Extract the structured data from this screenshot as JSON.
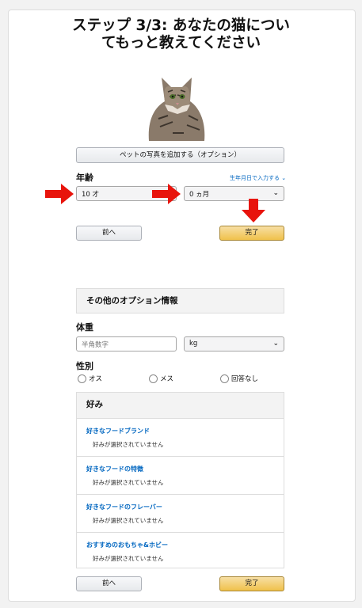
{
  "title": {
    "line1": "ステップ 3/3: あなたの猫につい",
    "line2": "てもっと教えてください"
  },
  "add_photo_label": "ペットの写真を追加する（オプション）",
  "age": {
    "label": "年齢",
    "birthday_link": "生年月日で入力する ⌄",
    "years_value": "10 才",
    "months_value": "0 ヵ月"
  },
  "nav": {
    "prev_label": "前へ",
    "done_label": "完了"
  },
  "optional": {
    "heading": "その他のオプション情報"
  },
  "weight": {
    "label": "体重",
    "placeholder": "半角数字",
    "unit_value": "kg"
  },
  "gender": {
    "label": "性別",
    "options": [
      "オス",
      "メス",
      "回答なし"
    ]
  },
  "preferences": {
    "heading": "好み",
    "items": [
      {
        "title": "好きなフードブランド",
        "status": "好みが選択されていません"
      },
      {
        "title": "好きなフードの特徴",
        "status": "好みが選択されていません"
      },
      {
        "title": "好きなフードのフレーバー",
        "status": "好みが選択されていません"
      },
      {
        "title": "おすすめのおもちゃ&ホビー",
        "status": "好みが選択されていません"
      }
    ]
  },
  "colors": {
    "accent_link": "#0066c0",
    "primary_button": "#f0c14b",
    "arrow": "#e8140c"
  },
  "icons": [
    "chevron-down-icon",
    "arrow-right-icon",
    "arrow-down-icon",
    "cat-photo"
  ]
}
